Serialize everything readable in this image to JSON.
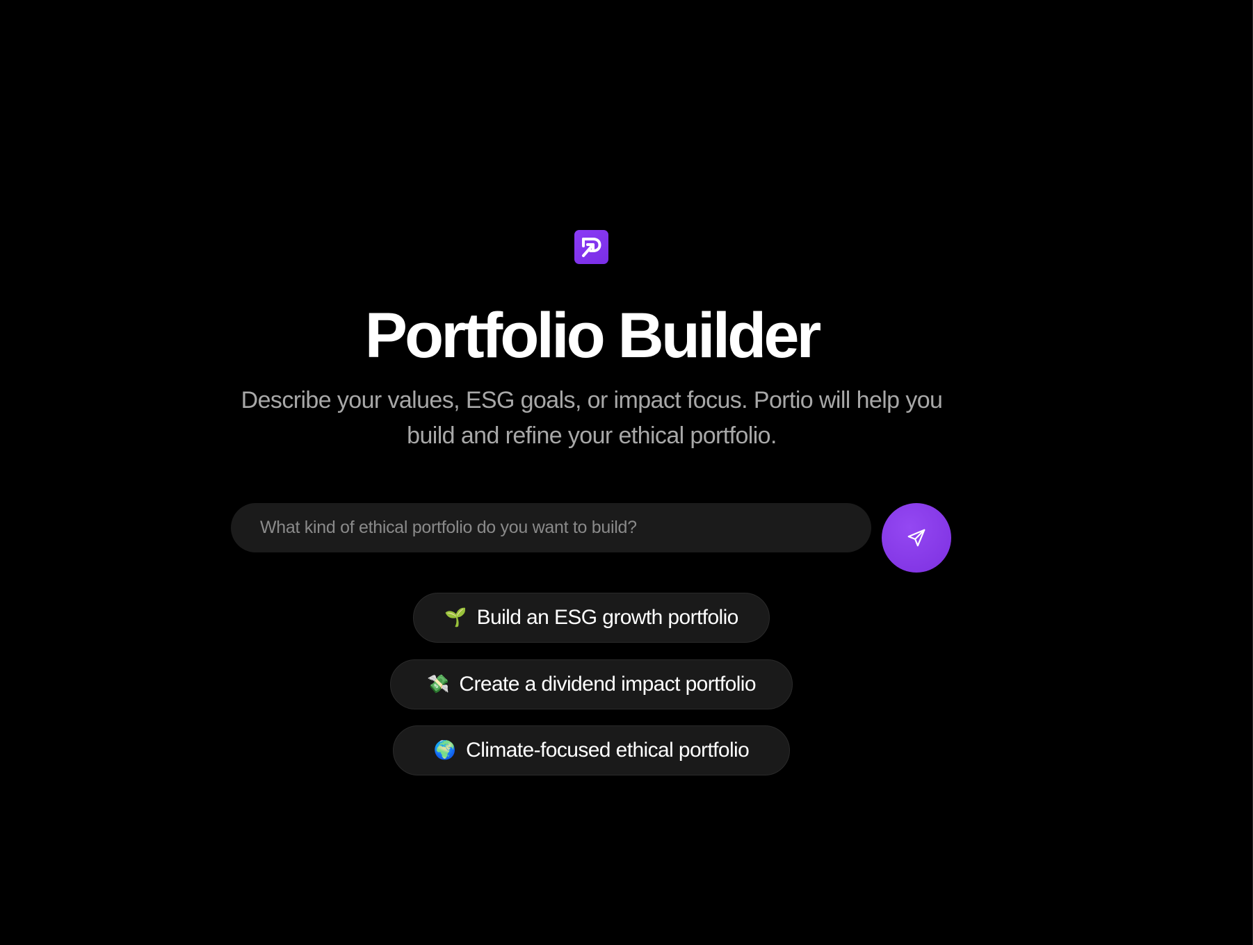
{
  "app": {
    "logo_icon": "portio-logo-icon",
    "accent_color": "#8b3cf5",
    "background_color": "#000000"
  },
  "hero": {
    "title": "Portfolio Builder",
    "subtitle": "Describe your values, ESG goals, or impact focus. Portio will help you build and refine your ethical portfolio."
  },
  "search": {
    "value": "",
    "placeholder": "What kind of ethical portfolio do you want to build?",
    "submit_icon": "send-icon"
  },
  "suggestions": [
    {
      "emoji": "🌱",
      "icon": "seedling-icon",
      "label": "Build an ESG growth portfolio"
    },
    {
      "emoji": "💸",
      "icon": "money-with-wings-icon",
      "label": "Create a dividend impact portfolio"
    },
    {
      "emoji": "🌍",
      "icon": "globe-icon",
      "label": "Climate-focused ethical portfolio"
    }
  ]
}
